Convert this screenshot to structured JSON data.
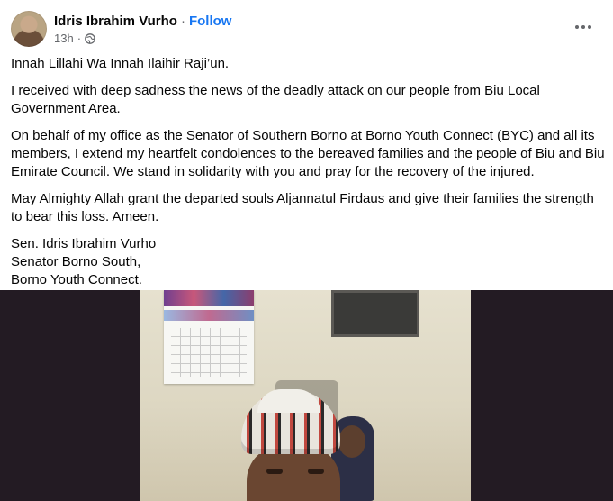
{
  "post": {
    "author": "Idris Ibrahim Vurho",
    "separator": "·",
    "follow_label": "Follow",
    "time": "13h",
    "time_separator": "·",
    "privacy_icon": "globe-icon",
    "more_icon": "more-options-icon"
  },
  "content": {
    "p1": "Innah Lillahi Wa Innah Ilaihir Raji’un.",
    "p2": "I received with deep sadness the news of the deadly attack on our people from Biu Local Government Area.",
    "p3": "On behalf of my office as the Senator of Southern Borno at Borno Youth Connect (BYC) and all its members, I extend my heartfelt condolences to the bereaved families and the people of Biu and Biu Emirate Council. We stand in solidarity with you and pray for the recovery of the injured.",
    "p4": "May Almighty Allah grant the departed souls Aljannatul Firdaus and give their families the strength to bear this loss. Ameen.",
    "signature": "Sen. Idris Ibrahim Vurho\nSenator Borno South,\nBorno Youth Connect."
  },
  "colors": {
    "follow": "#1877f2",
    "meta_text": "#65676b",
    "media_background": "#231b23"
  }
}
